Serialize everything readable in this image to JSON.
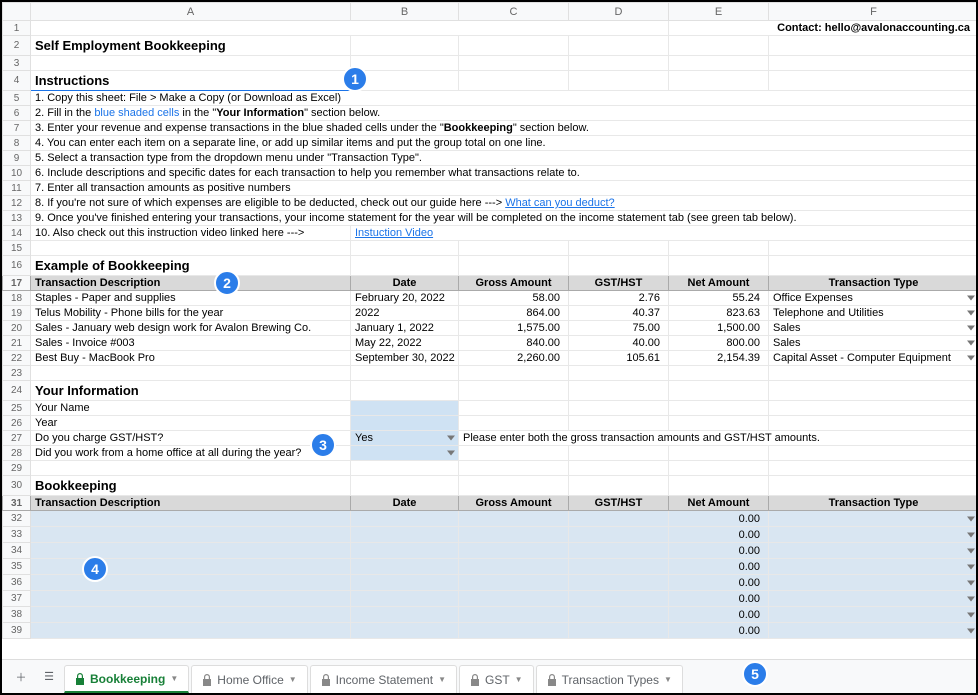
{
  "contact": "Contact: hello@avalonaccounting.ca",
  "title": "Self Employment Bookkeeping",
  "instr_hdr": "Instructions",
  "instr": {
    "r1": "1. Copy this sheet: File > Make a Copy (or Download as Excel)",
    "r2a": "2. Fill in the ",
    "r2b": "blue shaded cells",
    "r2c": " in the \"",
    "r2d": "Your Information",
    "r2e": "\" section below.",
    "r3a": "3. Enter your revenue and expense transactions in the blue shaded cells under the \"",
    "r3b": "Bookkeeping",
    "r3c": "\" section below.",
    "r4": "4. You can enter each item on a separate line, or add up similar items and put the group total on one line.",
    "r5": "5. Select a transaction type from the dropdown menu under \"Transaction Type\".",
    "r6": "6. Include descriptions and specific dates for each transaction to help you remember what transactions relate to.",
    "r7": "7. Enter all transaction amounts as positive numbers",
    "r8a": "8. If you're not sure of which expenses are eligible to be deducted, check out our guide here ---> ",
    "r8b": "What can you deduct?",
    "r9": "9. Once you've finished entering your transactions, your income statement for the year will be completed on the income statement tab (see green tab below).",
    "r10a": "10. Also check out this instruction video linked here --->",
    "r10b": "Instuction Video"
  },
  "example_hdr": "Example of Bookkeeping",
  "cols": {
    "desc": "Transaction Description",
    "date": "Date",
    "gross": "Gross Amount",
    "gst": "GST/HST",
    "net": "Net Amount",
    "type": "Transaction Type"
  },
  "ex": [
    {
      "desc": "Staples - Paper and supplies",
      "date": "February 20, 2022",
      "gross": "58.00",
      "gst": "2.76",
      "net": "55.24",
      "type": "Office Expenses"
    },
    {
      "desc": "Telus Mobility - Phone bills for the year",
      "date": "2022",
      "gross": "864.00",
      "gst": "40.37",
      "net": "823.63",
      "type": "Telephone and Utilities"
    },
    {
      "desc": "Sales - January web design work for Avalon Brewing Co.",
      "date": "January 1, 2022",
      "gross": "1,575.00",
      "gst": "75.00",
      "net": "1,500.00",
      "type": "Sales"
    },
    {
      "desc": "Sales - Invoice #003",
      "date": "May 22, 2022",
      "gross": "840.00",
      "gst": "40.00",
      "net": "800.00",
      "type": "Sales"
    },
    {
      "desc": "Best Buy - MacBook Pro",
      "date": "September 30, 2022",
      "gross": "2,260.00",
      "gst": "105.61",
      "net": "2,154.39",
      "type": "Capital Asset - Computer Equipment"
    }
  ],
  "yi_hdr": "Your Information",
  "yi": {
    "name": "Your Name",
    "year": "Year",
    "gst_q": "Do you charge GST/HST?",
    "gst_v": "Yes",
    "gst_note": "Please enter both the gross transaction amounts and GST/HST amounts.",
    "ho_q": "Did you work from a home office at all during the year?"
  },
  "bk_hdr": "Bookkeeping",
  "bk_zero": "0.00",
  "tabs": [
    "Bookkeeping",
    "Home Office",
    "Income Statement",
    "GST",
    "Transaction Types"
  ],
  "badges": [
    "1",
    "2",
    "3",
    "4",
    "5"
  ],
  "col_letters": [
    "A",
    "B",
    "C",
    "D",
    "E",
    "F"
  ],
  "icons": {
    "lock": "lock-icon"
  }
}
